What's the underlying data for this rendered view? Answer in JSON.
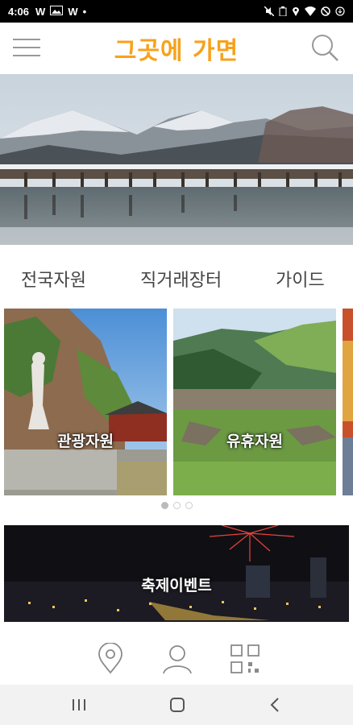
{
  "status_bar": {
    "time": "4:06",
    "left_icons": [
      "W",
      "W"
    ],
    "right_icons": [
      "mute-icon",
      "battery-saver-icon",
      "location-icon",
      "wifi-icon",
      "dnd-icon",
      "battery-icon"
    ]
  },
  "header": {
    "title": "그곳에 가면",
    "title_color": "#f7a21b"
  },
  "tabs": [
    {
      "label": "전국자원"
    },
    {
      "label": "직거래장터"
    },
    {
      "label": "가이드"
    }
  ],
  "cards": [
    {
      "label": "관광자원"
    },
    {
      "label": "유휴자원"
    }
  ],
  "carousel": {
    "pages": 3,
    "active_page": 1
  },
  "festival": {
    "label": "축제이벤트"
  },
  "bottom_bar": {
    "icons": [
      "location-pin-icon",
      "user-icon",
      "qr-code-icon"
    ]
  },
  "nav_bar": {
    "icons": [
      "recent-apps-icon",
      "home-icon",
      "back-icon"
    ]
  }
}
